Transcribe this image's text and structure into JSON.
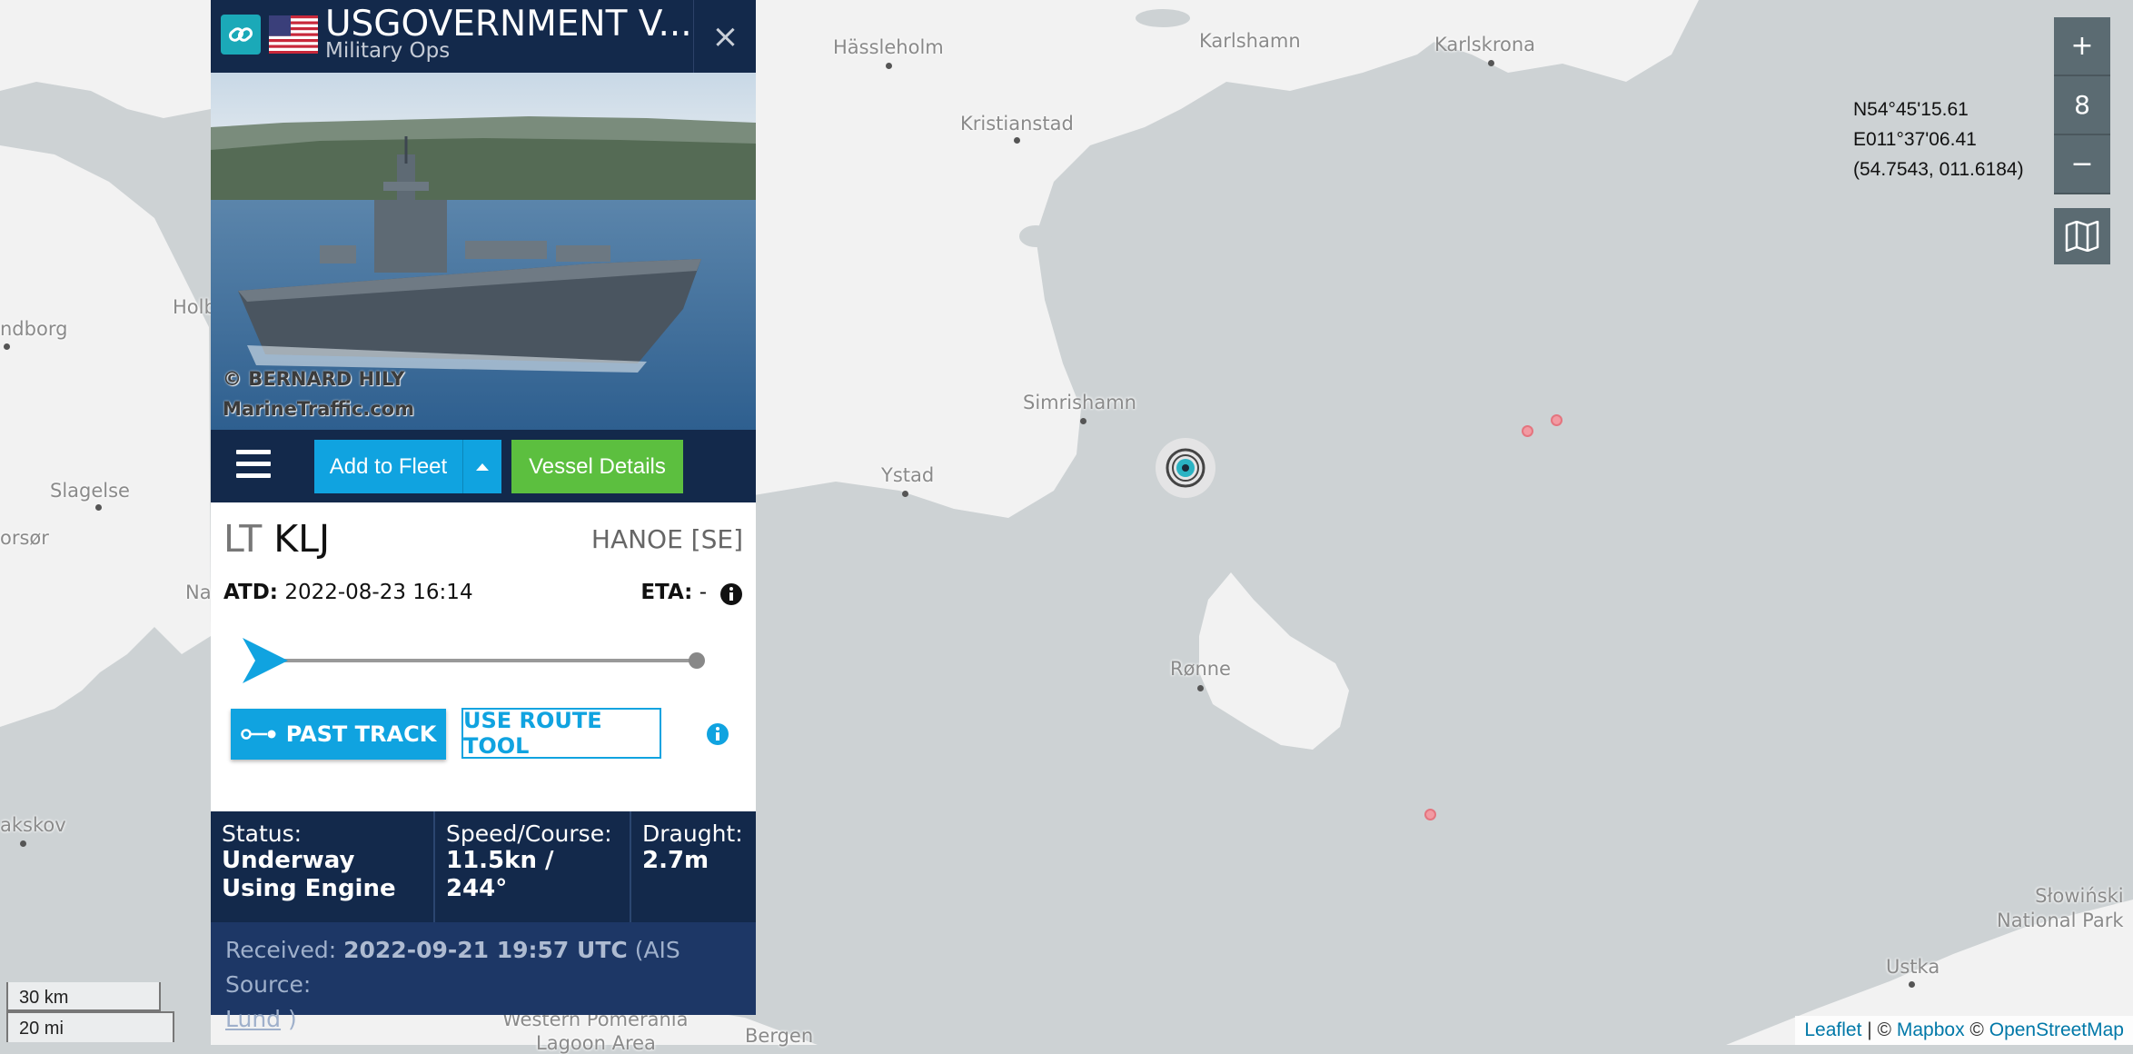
{
  "map": {
    "places": {
      "hassleholm": "Hässleholm",
      "karlshamn": "Karlshamn",
      "karlskrona": "Karlskrona",
      "kristianstad": "Kristianstad",
      "simrishamn": "Simrishamn",
      "ystad": "Ystad",
      "ronne": "Rønne",
      "slagelse": "Slagelse",
      "korsor": "orsør",
      "holb": "Holb",
      "kalundborg": "ndborg",
      "naestved": "Na",
      "nakskov": "akskov",
      "slowinski": "Słowiński\nNational Park",
      "ustka": "Ustka",
      "western_pomerania": "Western Pomerania",
      "lagoon": "Lagoon Area",
      "bergen": "Bergen"
    },
    "zoom_in_label": "+",
    "zoom_level": "8",
    "zoom_out_label": "−",
    "layers_icon": "map-icon",
    "coords": {
      "lat": "N54°45'15.61",
      "lon": "E011°37'06.41",
      "decimal": "(54.7543, 011.6184)"
    },
    "scale": {
      "km": "30 km",
      "mi": "20 mi"
    },
    "attribution": {
      "leaflet": "Leaflet",
      "sep1": " | © ",
      "mapbox": "Mapbox",
      "sep2": " © ",
      "osm": "OpenStreetMap"
    },
    "colors": {
      "sea": "#cdd2d4",
      "land": "#f2f2f2",
      "marker": "#f29aa2"
    }
  },
  "panel": {
    "vessel_name": "USGOVERNMENT V...",
    "vessel_type": "Military Ops",
    "close_label": "×",
    "photo_credit_1": "© BERNARD HILY",
    "photo_credit_2": "MarineTraffic.com",
    "toolbar": {
      "add_to_fleet": "Add to Fleet",
      "vessel_details": "Vessel Details"
    },
    "voyage": {
      "from_prefix": "LT",
      "from_port": "KLJ",
      "destination": "HANOE [SE]",
      "atd_label": "ATD:",
      "atd_value": "2022-08-23 16:14",
      "eta_label": "ETA:",
      "eta_value": "-",
      "progress": 0.0
    },
    "buttons": {
      "past_track": "PAST TRACK",
      "route_tool": "USE ROUTE TOOL"
    },
    "stats": {
      "status_label": "Status:",
      "status_value": "Underway Using Engine",
      "speed_label": "Speed/Course:",
      "speed_value": "11.5kn / 244°",
      "draught_label": "Draught:",
      "draught_value": "2.7m"
    },
    "received": {
      "label": "Received:",
      "value": "2022-09-21 19:57 UTC",
      "source_prefix": "(AIS Source:",
      "source": "Lund",
      "source_suffix": ")"
    },
    "colors": {
      "header": "#13294b",
      "accent": "#10a3e0",
      "green": "#5cbf3f"
    }
  }
}
